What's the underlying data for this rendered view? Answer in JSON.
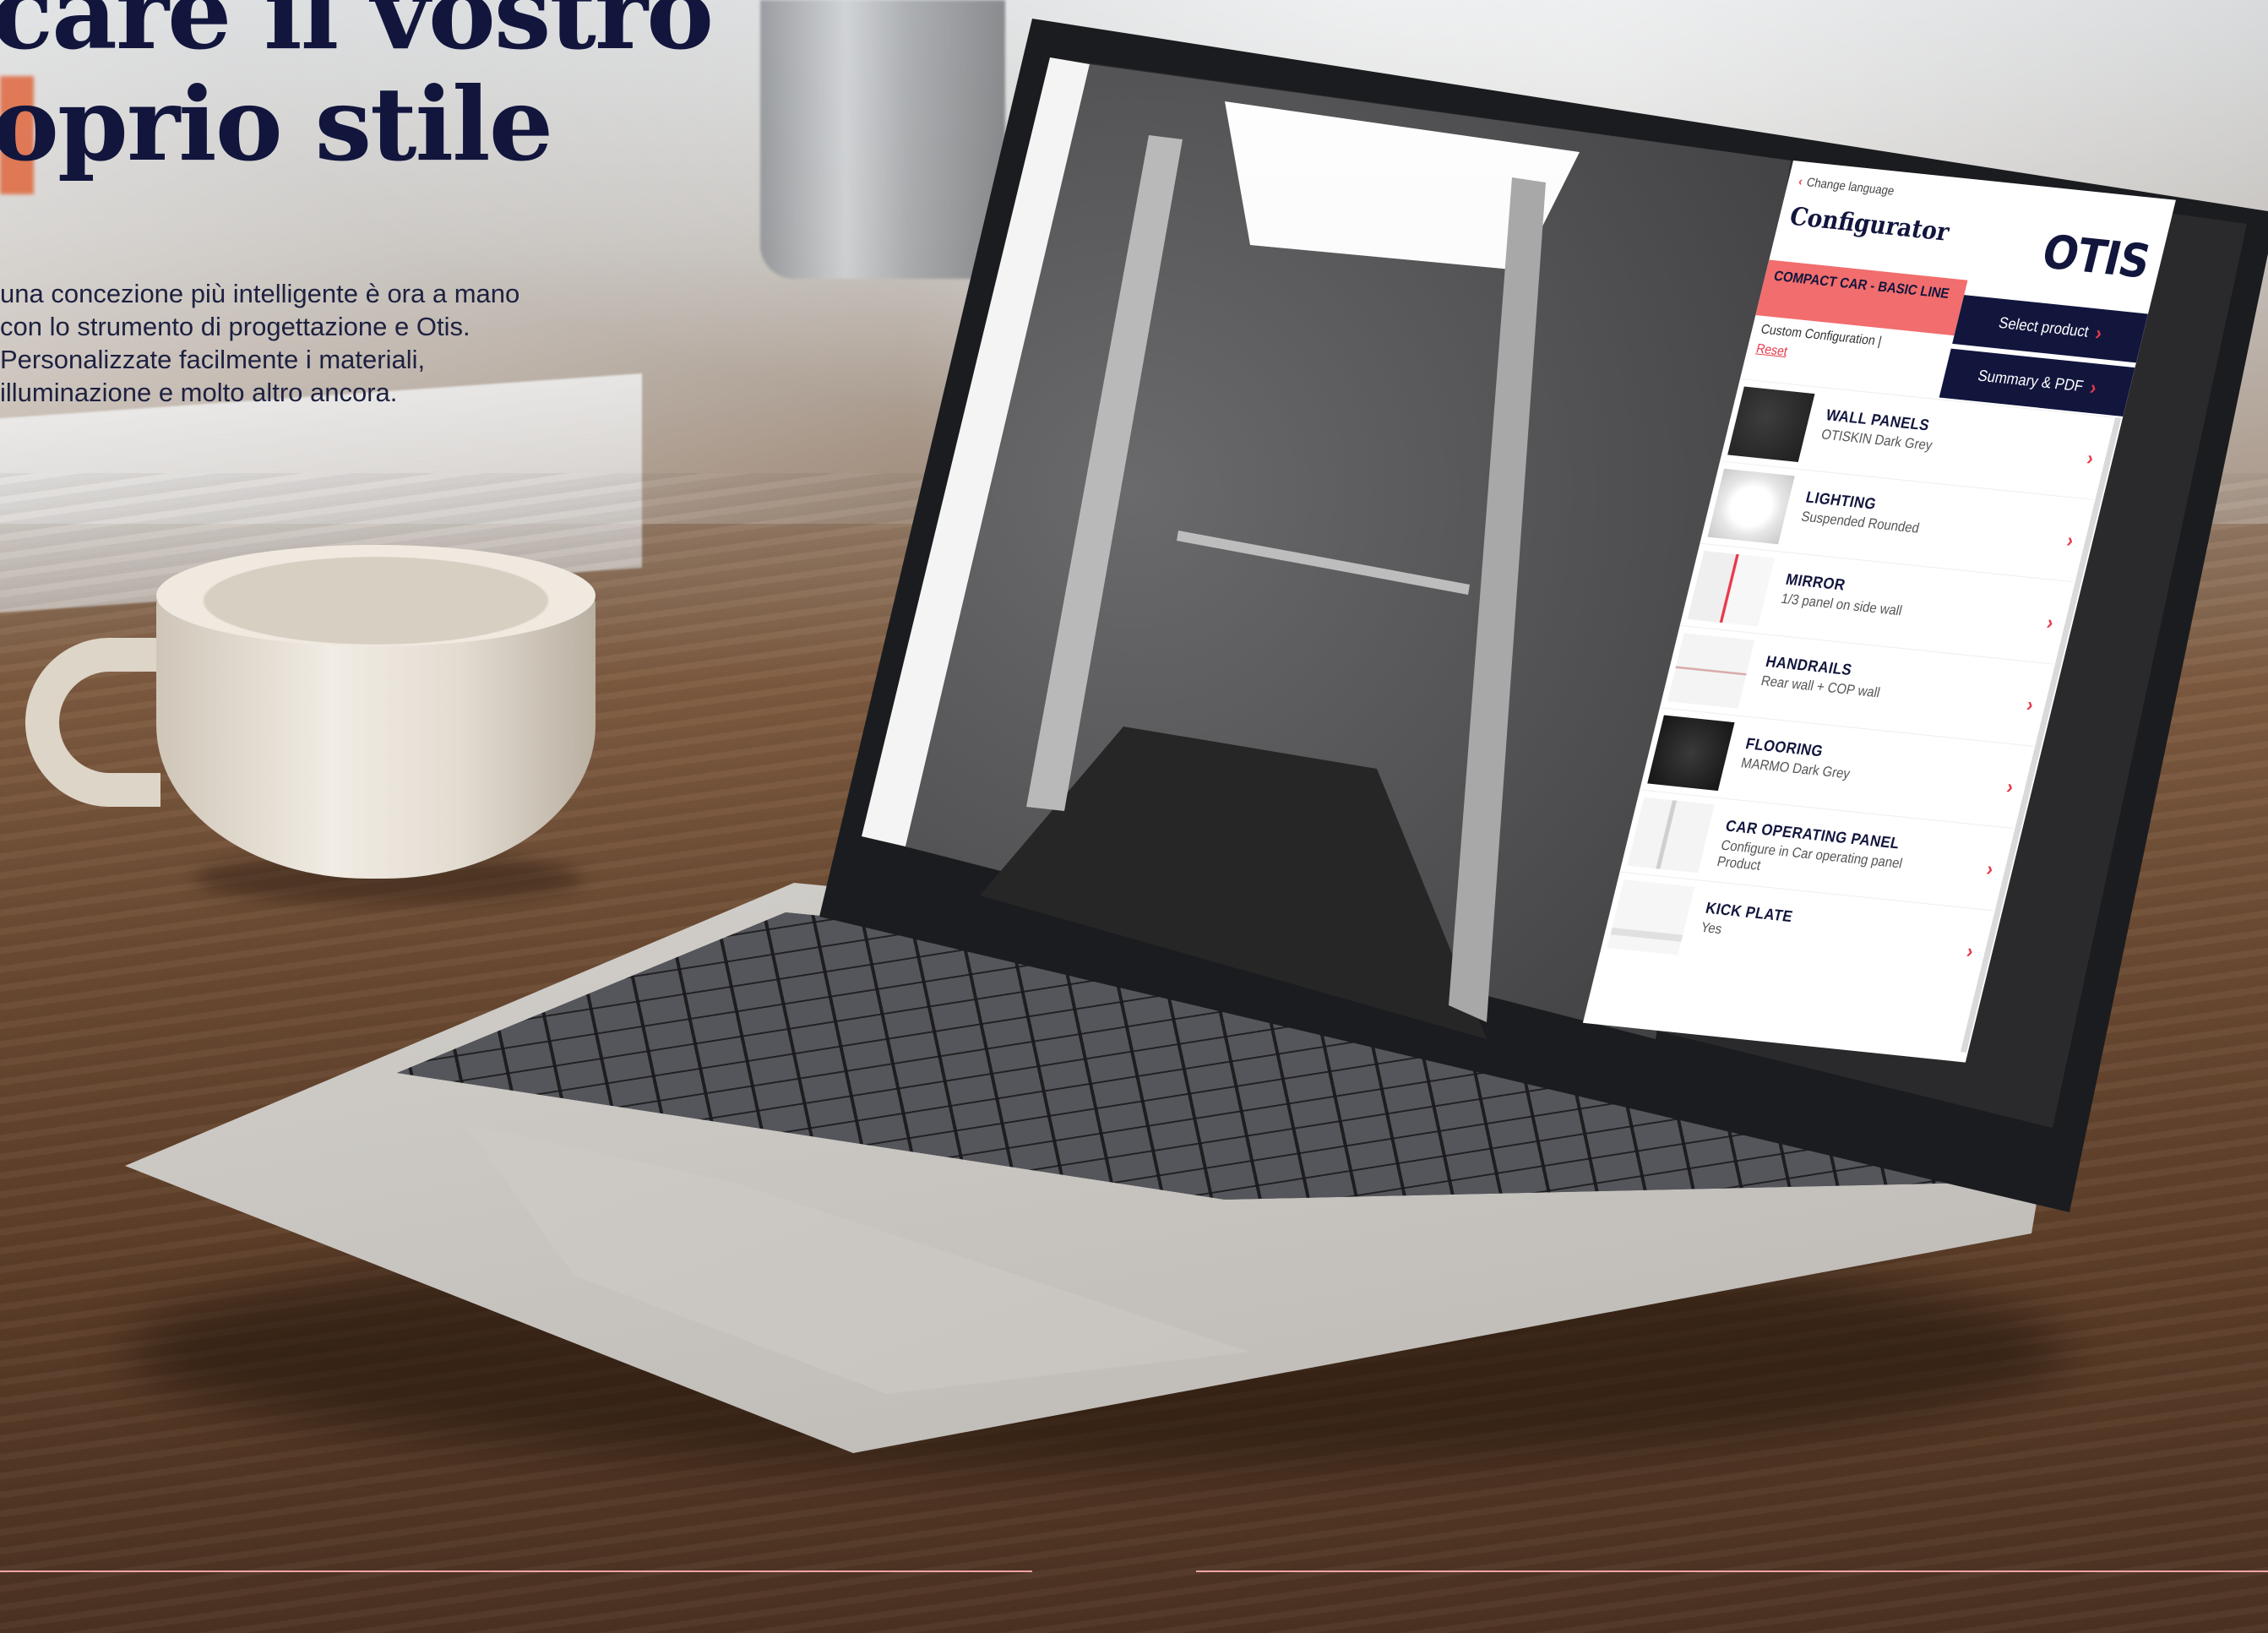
{
  "headline": {
    "line1": "care il vostro",
    "line2": "oprio stile"
  },
  "intro": "una concezione più intelligente è ora a mano con lo strumento di progettazione e Otis. Personalizzate facilmente i materiali, illuminazione e molto altro ancora.",
  "configurator": {
    "change_language": "Change language",
    "title": "Configurator",
    "logo": "OTIS",
    "product": "COMPACT CAR - BASIC LINE",
    "custom_configuration": "Custom Configuration |",
    "reset": "Reset",
    "select_product": "Select product",
    "summary_pdf": "Summary & PDF",
    "items": [
      {
        "name": "WALL PANELS",
        "value": "OTISKIN Dark Grey"
      },
      {
        "name": "LIGHTING",
        "value": "Suspended Rounded"
      },
      {
        "name": "MIRROR",
        "value": "1/3 panel on side wall"
      },
      {
        "name": "HANDRAILS",
        "value": "Rear wall + COP wall"
      },
      {
        "name": "FLOORING",
        "value": "MARMO Dark Grey"
      },
      {
        "name": "CAR OPERATING PANEL",
        "value": "Configure in Car operating panel Product"
      },
      {
        "name": "KICK PLATE",
        "value": "Yes"
      }
    ]
  },
  "colors": {
    "navy": "#12163d",
    "accent_red": "#e8394a",
    "product_bar": "#f26d6d",
    "divider_pink": "#f0a3a6"
  },
  "icons": {
    "back": "chevron-left-icon",
    "row_arrow": "chevron-right-icon"
  }
}
